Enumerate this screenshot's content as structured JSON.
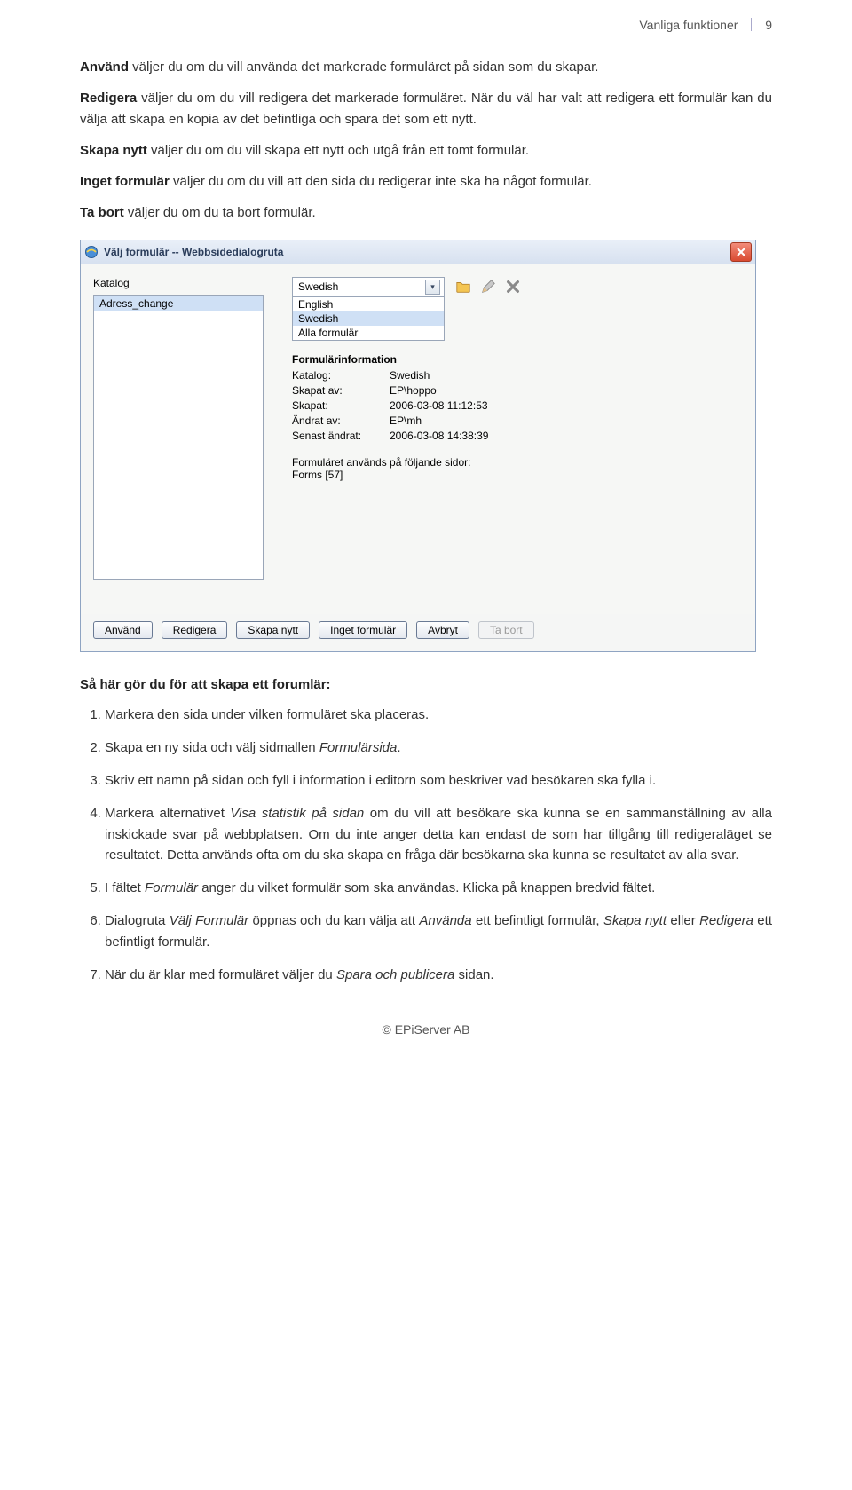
{
  "header": {
    "section": "Vanliga funktioner",
    "page_num": "9"
  },
  "intro_paras": {
    "p1_b": "Använd",
    "p1": " väljer du om du vill använda det markerade formuläret på sidan som du skapar.",
    "p2_b": "Redigera",
    "p2": " väljer du om du vill redigera det markerade formuläret. När du väl har valt att redigera ett formulär kan du välja att skapa en kopia av det befintliga och spara det som ett nytt.",
    "p3_b": "Skapa nytt",
    "p3": " väljer du om du vill skapa ett nytt och utgå från ett tomt formulär.",
    "p4_b": "Inget formulär",
    "p4": " väljer du om du vill att den sida du redigerar inte ska ha något formulär.",
    "p5_b": "Ta bort",
    "p5": " väljer du om du ta bort formulär."
  },
  "dialog": {
    "title": "Välj formulär -- Webbsidedialogruta",
    "left": {
      "label": "Katalog",
      "list_item": "Adress_change"
    },
    "katalog_select": {
      "selected": "Swedish",
      "options": [
        "English",
        "Swedish",
        "Alla formulär"
      ]
    },
    "icons": {
      "folder": "folder-icon",
      "edit": "pencil-icon",
      "delete": "delete-x-icon"
    },
    "info": {
      "heading": "Formulärinformation",
      "rows": [
        {
          "k": "Katalog:",
          "v": "Swedish"
        },
        {
          "k": "Skapat av:",
          "v": "EP\\hoppo"
        },
        {
          "k": "Skapat:",
          "v": "2006-03-08 11:12:53"
        },
        {
          "k": "Ändrat av:",
          "v": "EP\\mh"
        },
        {
          "k": "Senast ändrat:",
          "v": "2006-03-08 14:38:39"
        }
      ],
      "usage_line": "Formuläret används på följande sidor:",
      "usage_value": "Forms [57]"
    },
    "buttons": {
      "b1": "Använd",
      "b2": "Redigera",
      "b3": "Skapa nytt",
      "b4": "Inget formulär",
      "b5": "Avbryt",
      "b6": "Ta bort"
    }
  },
  "after": {
    "heading": "Så här gör du för att skapa ett forumlär:",
    "steps": {
      "s1": "Markera den sida under vilken formuläret ska placeras.",
      "s2a": "Skapa en ny sida och välj sidmallen ",
      "s2i": "Formulärsida",
      "s2b": ".",
      "s3": "Skriv ett namn på sidan och fyll i information i editorn som beskriver vad besökaren ska fylla i.",
      "s4a": "Markera alternativet ",
      "s4i": "Visa statistik på sidan",
      "s4b": " om du vill att besökare ska kunna se en sammanställning av alla inskickade svar på webbplatsen. Om du inte anger detta kan endast de som har tillgång till redigeraläget se resultatet. Detta används ofta om du ska skapa en fråga där besökarna ska kunna se resultatet av alla svar.",
      "s5a": "I fältet ",
      "s5i": "Formulär",
      "s5b": " anger du vilket formulär som ska användas. Klicka på knappen bredvid fältet.",
      "s6a": "Dialogruta ",
      "s6i1": "Välj Formulär",
      "s6b": " öppnas och du kan välja att ",
      "s6i2": "Använda",
      "s6c": " ett befintligt formulär, ",
      "s6i3": "Skapa nytt",
      "s6d": " eller ",
      "s6i4": "Redigera",
      "s6e": " ett befintligt formulär.",
      "s7a": "När du är klar med formuläret väljer du ",
      "s7i": "Spara och publicera",
      "s7b": " sidan."
    }
  },
  "footer": "© EPiServer AB"
}
